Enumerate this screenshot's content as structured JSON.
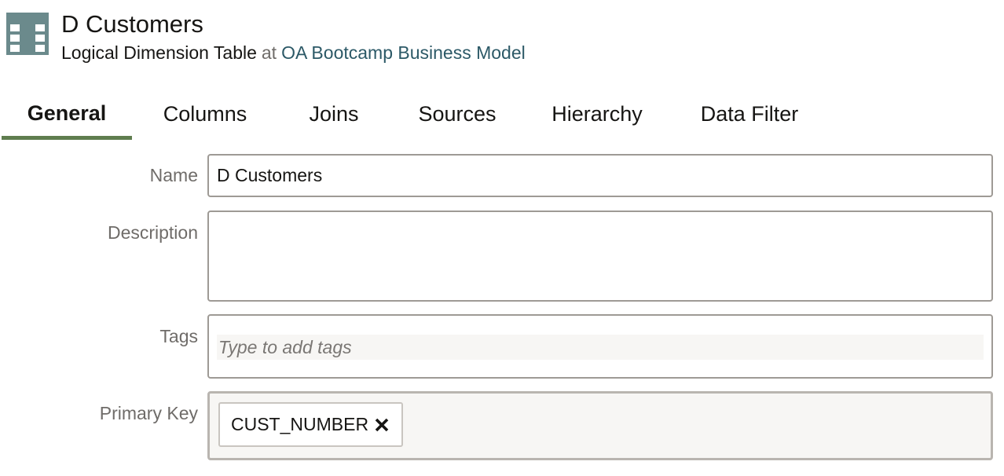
{
  "header": {
    "icon": "logical-table-icon",
    "icon_color": "#6b8a8c",
    "title": "D Customers",
    "subtitle_type": "Logical Dimension Table",
    "subtitle_at": "at",
    "subtitle_link": "OA Bootcamp Business Model",
    "link_color": "#2c5967"
  },
  "tabs": [
    {
      "label": "General",
      "active": true
    },
    {
      "label": "Columns",
      "active": false
    },
    {
      "label": "Joins",
      "active": false
    },
    {
      "label": "Sources",
      "active": false
    },
    {
      "label": "Hierarchy",
      "active": false
    },
    {
      "label": "Data Filter",
      "active": false
    }
  ],
  "accent_color": "#5f7d4f",
  "form": {
    "name": {
      "label": "Name",
      "value": "D Customers"
    },
    "description": {
      "label": "Description",
      "value": ""
    },
    "tags": {
      "label": "Tags",
      "placeholder": "Type to add tags"
    },
    "primary_key": {
      "label": "Primary Key",
      "chips": [
        {
          "label": "CUST_NUMBER",
          "remove_icon": "close-icon"
        }
      ]
    }
  }
}
